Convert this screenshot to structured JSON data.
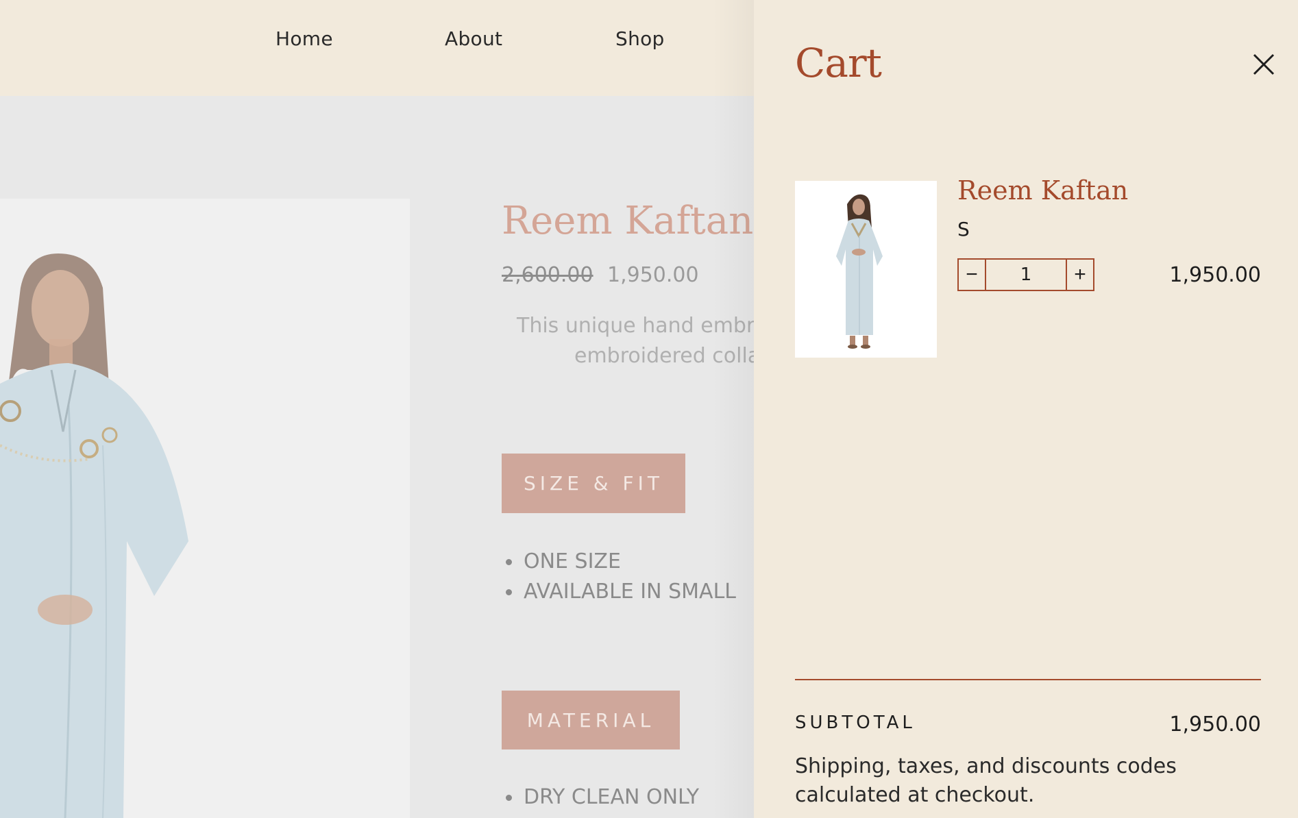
{
  "nav": {
    "items": [
      {
        "label": "Home"
      },
      {
        "label": "About"
      },
      {
        "label": "Shop"
      }
    ]
  },
  "product": {
    "title": "Reem Kaftan",
    "old_price": "2,600.00",
    "price": "1,950.00",
    "description_line1": "This unique hand embro",
    "description_line2": "embroidered colla",
    "size_fit_label": "SIZE & FIT",
    "size_fit_items": [
      "ONE SIZE",
      "AVAILABLE IN SMALL"
    ],
    "material_label": "MATERIAL",
    "material_items": [
      "DRY CLEAN ONLY"
    ]
  },
  "cart": {
    "title": "Cart",
    "close_icon": "close-icon",
    "item": {
      "name": "Reem Kaftan",
      "variant": "S",
      "quantity": "1",
      "price": "1,950.00",
      "minus_symbol": "−",
      "plus_symbol": "+"
    },
    "subtotal_label": "SUBTOTAL",
    "subtotal_value": "1,950.00",
    "shipping_note": "Shipping, taxes, and discounts codes calculated at checkout."
  },
  "colors": {
    "accent": "#a44a2c",
    "drawer_bg": "#f2eadc",
    "button_bg": "#cfa79b"
  }
}
